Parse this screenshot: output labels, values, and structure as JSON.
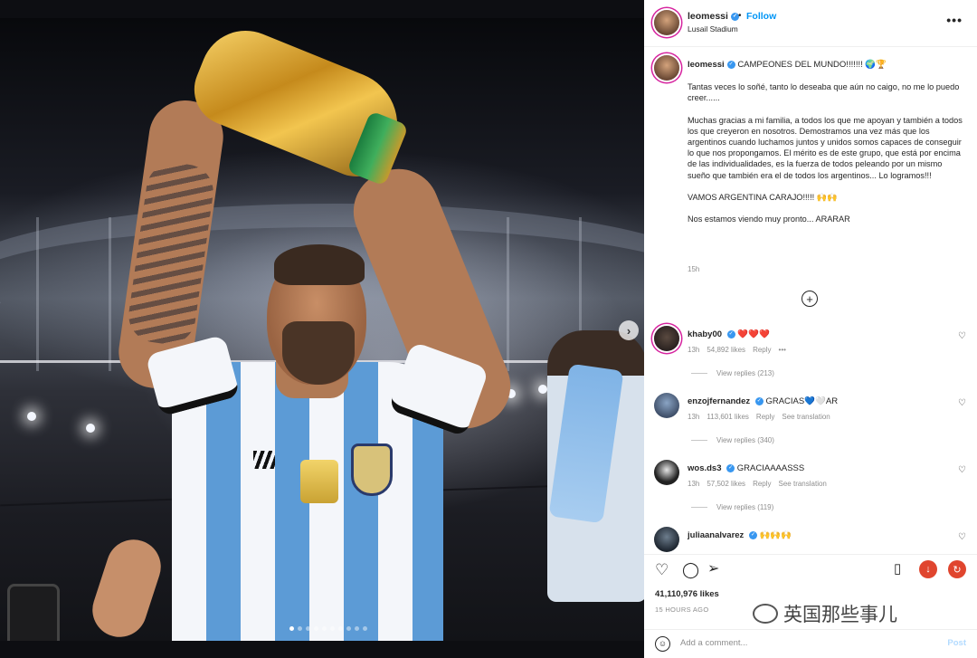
{
  "post": {
    "username": "leomessi",
    "follow_label": "Follow",
    "location": "Lusail Stadium",
    "more_icon": "more-horizontal-icon"
  },
  "caption": {
    "username": "leomessi",
    "headline": "CAMPEONES DEL MUNDO!!!!!!! 🌍🏆",
    "body": "Tantas veces lo soñé, tanto lo deseaba que aún no caigo, no me lo puedo creer......\n\nMuchas gracias a mi familia, a todos los que me apoyan y también a todos los que creyeron en nosotros. Demostramos una vez más que los argentinos cuando luchamos juntos y unidos somos capaces de conseguir lo que nos propongamos. El mérito es de este grupo, que está por encima de las individualidades, es la fuerza de todos peleando por un mismo sueño que también era el de todos los argentinos... Lo logramos!!!\n\nVAMOS ARGENTINA CARAJO!!!!! 🙌🙌\n\nNos estamos viendo muy pronto... ARARAR",
    "time": "15h"
  },
  "comments": [
    {
      "username": "khaby00",
      "text": "❤️❤️❤️",
      "time": "13h",
      "likes": "54,892 likes",
      "reply": "Reply",
      "extra": "•••",
      "replies": "View replies (213)"
    },
    {
      "username": "enzojfernandez",
      "text": "GRACIAS💙🤍AR",
      "time": "13h",
      "likes": "113,601 likes",
      "reply": "Reply",
      "extra": "See translation",
      "replies": "View replies (340)"
    },
    {
      "username": "wos.ds3",
      "text": "GRACIAAAASSS",
      "time": "13h",
      "likes": "57,502 likes",
      "reply": "Reply",
      "extra": "See translation",
      "replies": "View replies (119)"
    },
    {
      "username": "juliaanalvarez",
      "text": "🙌🙌🙌",
      "time": "",
      "likes": "",
      "reply": "",
      "extra": "",
      "replies": ""
    }
  ],
  "actions": {
    "likes": "41,110,976 likes",
    "time": "15 HOURS AGO"
  },
  "add_comment": {
    "placeholder": "Add a comment...",
    "post_label": "Post"
  },
  "watermark": "英国那些事儿",
  "colors": {
    "accent": "#0095f6",
    "verified": "#3897f0",
    "heart": "#ed4956"
  }
}
